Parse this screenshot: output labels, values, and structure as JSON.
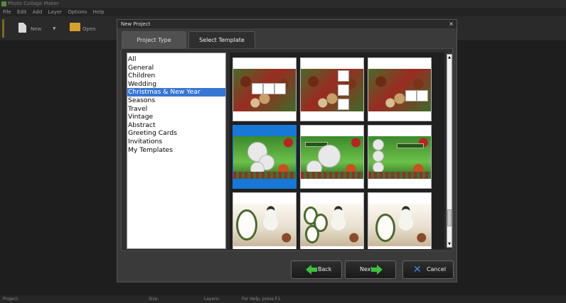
{
  "app": {
    "title": "Photo Collage Maker"
  },
  "menu": [
    "File",
    "Edit",
    "Add",
    "Layer",
    "Options",
    "Help"
  ],
  "toolbar": {
    "new_label": "New",
    "open_label": "Open"
  },
  "dialog": {
    "title": "New Project",
    "close": "×",
    "tabs": [
      {
        "label": "Project Type"
      },
      {
        "label": "Select Template"
      }
    ],
    "categories": [
      "All",
      "General",
      "Children",
      "Wedding",
      "Christmas & New Year",
      "Seasons",
      "Travel",
      "Vintage",
      "Abstract",
      "Greeting Cards",
      "Invitations",
      "My Templates"
    ],
    "selected_category": 4,
    "templates": [
      {
        "name": "christmas-chocolates-1"
      },
      {
        "name": "christmas-chocolates-2"
      },
      {
        "name": "christmas-chocolates-3"
      },
      {
        "name": "christmas-green-1",
        "selected": true
      },
      {
        "name": "christmas-green-2"
      },
      {
        "name": "christmas-green-3"
      },
      {
        "name": "christmas-snowman-1"
      },
      {
        "name": "christmas-snowman-2"
      },
      {
        "name": "christmas-snowman-3"
      }
    ],
    "buttons": {
      "back": "Back",
      "next": "Next",
      "cancel": "Cancel"
    },
    "icons": {
      "back": "arrow-left-icon",
      "next": "arrow-right-icon",
      "cancel": "x-icon"
    }
  },
  "status": {
    "project": "Project:",
    "size": "Size:",
    "layers": "Layers:",
    "help": "For Help, press F1."
  },
  "colors": {
    "accent": "#3876d4",
    "selection": "#1778d8",
    "arrow": "#3ec03a"
  }
}
